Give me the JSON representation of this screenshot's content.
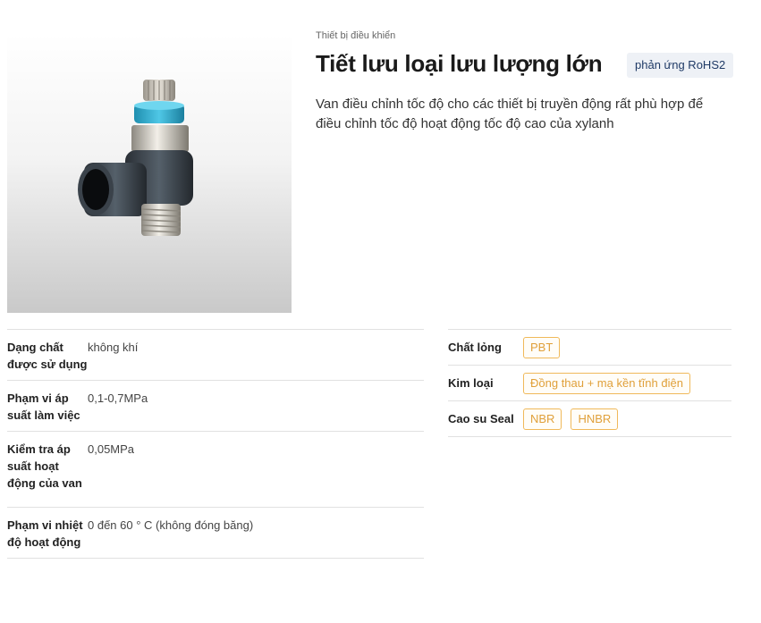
{
  "product": {
    "category": "Thiết bị điều khiển",
    "title": "Tiết lưu loại lưu lượng lớn",
    "badge": "phản ứng RoHS2",
    "description": "Van điều chỉnh tốc độ cho các thiết bị truyền động rất phù hợp để điều chỉnh tốc độ hoạt động tốc độ cao của xylanh",
    "image_icon": "speed-controller-fitting"
  },
  "specs": [
    {
      "label": "Dạng chất được sử dụng",
      "value": "không khí"
    },
    {
      "label": "Phạm vi áp suất làm việc",
      "value": "0,1-0,7MPa"
    },
    {
      "label": "Kiểm tra áp suất hoạt động của van",
      "value": "0,05MPa"
    },
    {
      "label": "Phạm vi nhiệt độ hoạt động",
      "value": "0 đến 60 ° C (không đóng băng)"
    }
  ],
  "materials": [
    {
      "label": "Chất lỏng",
      "tags": [
        "PBT"
      ]
    },
    {
      "label": "Kim loại",
      "tags": [
        "Đồng thau + mạ kền tĩnh điện"
      ]
    },
    {
      "label": "Cao su Seal",
      "tags": [
        "NBR",
        "HNBR"
      ]
    }
  ],
  "colors": {
    "badge_bg": "#eef1f6",
    "badge_text": "#1f3a66",
    "tag_border": "#f0b95a",
    "tag_text": "#e0a03a"
  }
}
